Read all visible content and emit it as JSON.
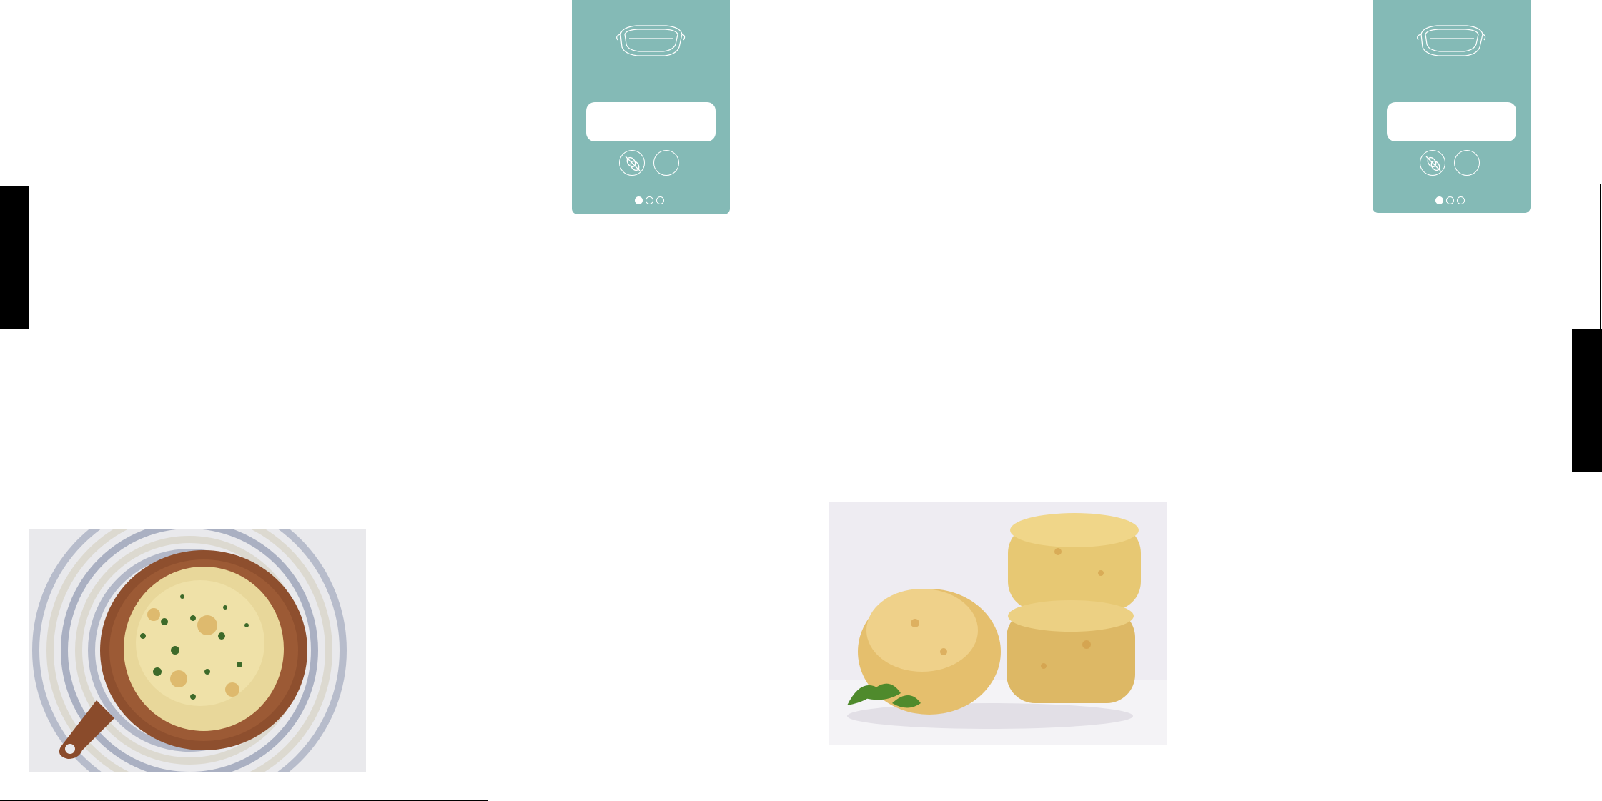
{
  "page": {
    "background": "#ffffff",
    "accent": "#84bab6"
  },
  "panels": [
    {
      "id": "left",
      "icons": [
        "baking-dish-icon",
        "nut-free-icon",
        "blank-circle-icon"
      ],
      "dots": {
        "count": 3,
        "active": 1
      }
    },
    {
      "id": "right",
      "icons": [
        "baking-dish-icon",
        "nut-free-icon",
        "blank-circle-icon"
      ],
      "dots": {
        "count": 3,
        "active": 1
      }
    }
  ],
  "photos": [
    {
      "subject": "flatbread"
    },
    {
      "subject": "scones"
    }
  ],
  "footer": {
    "text": ""
  }
}
